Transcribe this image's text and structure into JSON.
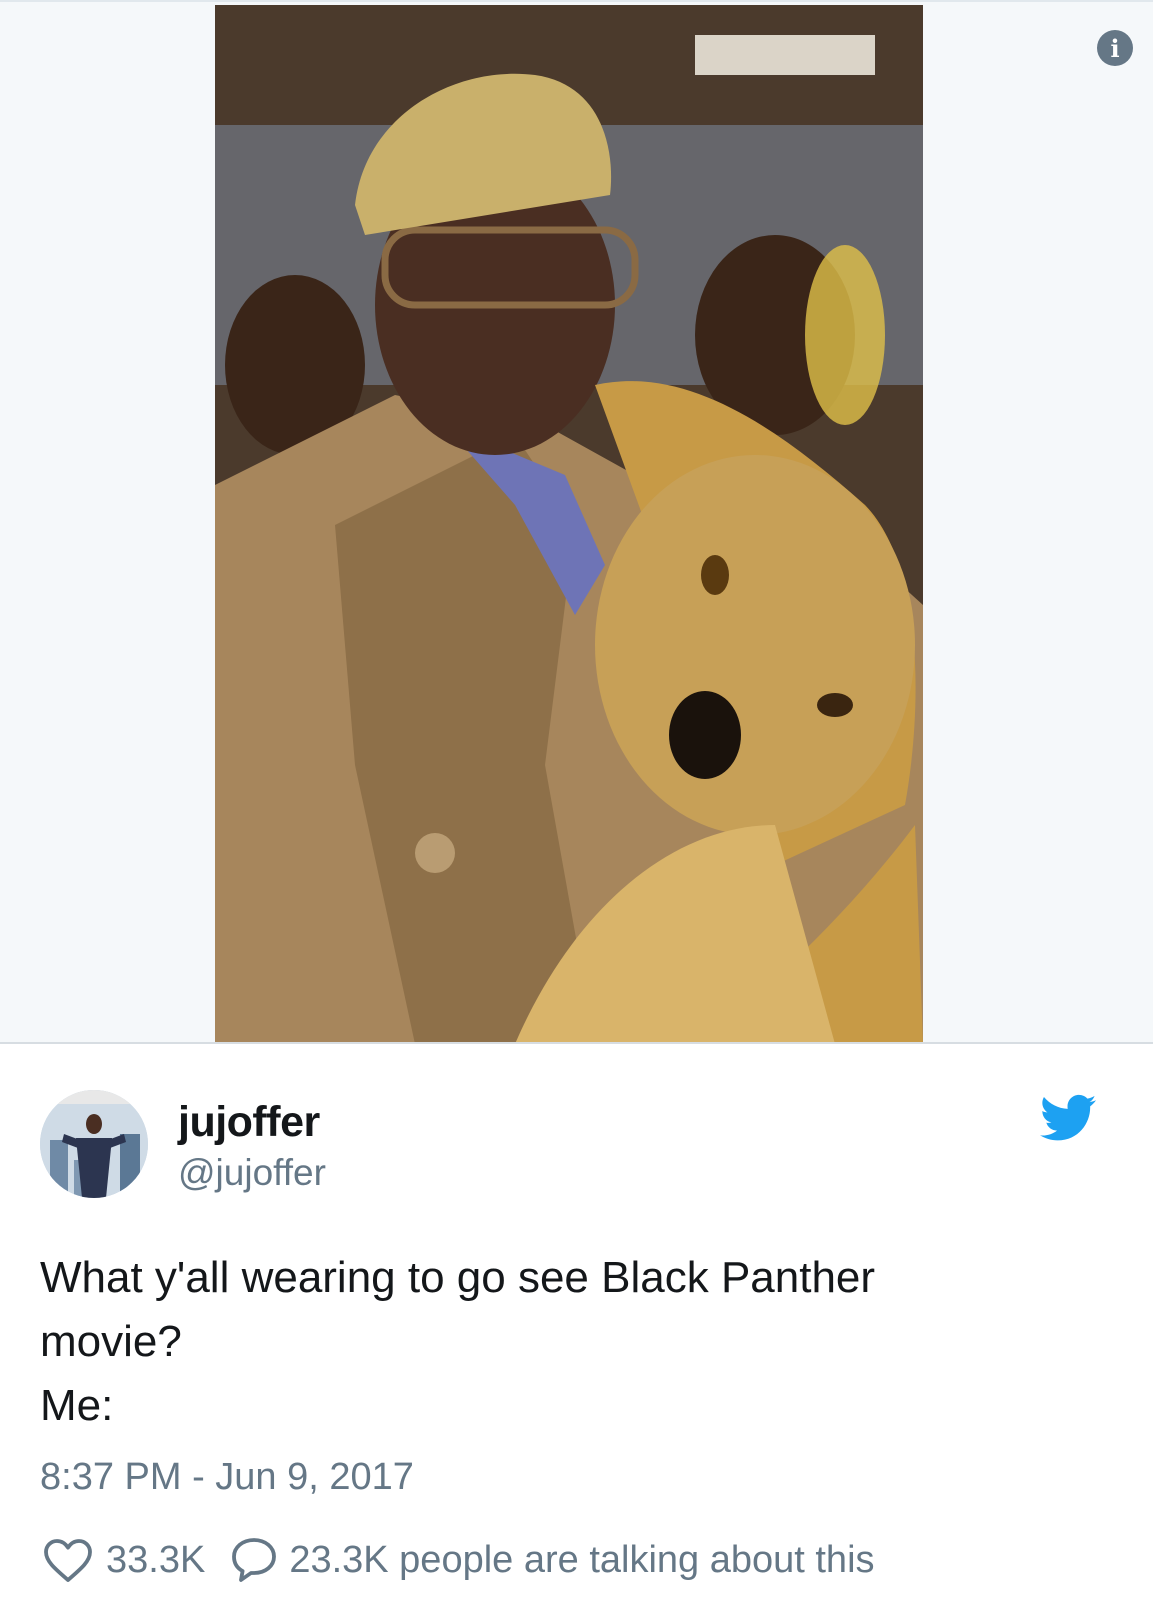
{
  "media": {
    "info_icon": "info-icon",
    "info_glyph": "i"
  },
  "tweet": {
    "display_name": "jujoffer",
    "handle": "@jujoffer",
    "brand_icon": "twitter-bird-icon",
    "brand_color": "#1da1f2",
    "text_lines": [
      "What y'all wearing to go see Black Panther",
      "movie?",
      "Me:"
    ],
    "timestamp": "8:37 PM - Jun 9, 2017",
    "likes": "33.3K",
    "like_icon": "heart-icon",
    "talking_icon": "speech-bubble-icon",
    "talking": "23.3K people are talking about this"
  }
}
